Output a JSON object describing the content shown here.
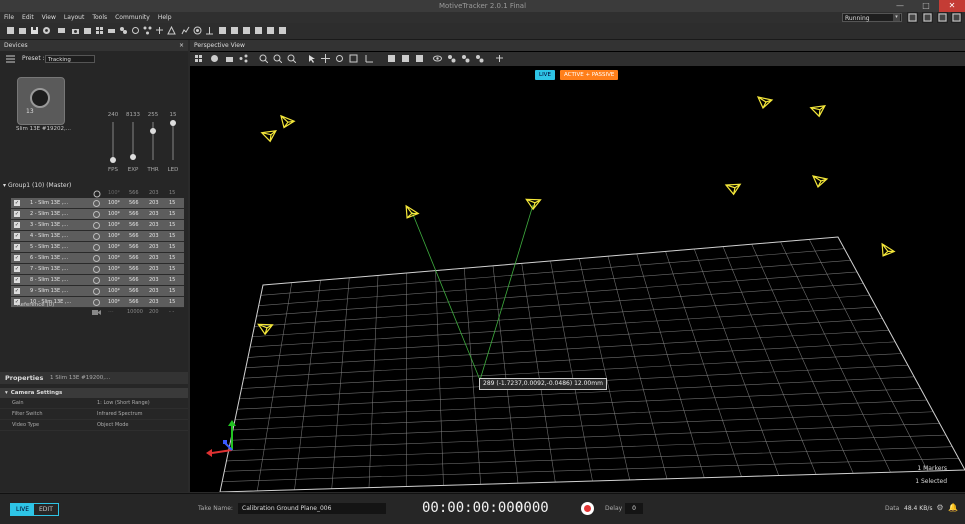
{
  "app": {
    "title": "MotiveTracker 2.0.1 Final"
  },
  "window": {
    "minimize": "—",
    "maximize": "□",
    "close": "✕"
  },
  "menu": [
    "File",
    "Edit",
    "View",
    "Layout",
    "Tools",
    "Community",
    "Help"
  ],
  "toolbar_right": {
    "mode_select": "Running",
    "mode_arrow": "▾"
  },
  "devices_panel": {
    "title": "Devices",
    "close": "×",
    "preset_label": "Preset :",
    "preset_value": "Tracking",
    "camera_name": "Slim 13E #19202,...",
    "camera_number": "13",
    "sliders": [
      {
        "value": "240",
        "label": "FPS",
        "level": 0.0
      },
      {
        "value": "8133",
        "label": "EXP",
        "level": 0.0
      },
      {
        "value": "255",
        "label": "THR",
        "level": 1.0
      },
      {
        "value": "15",
        "label": "LED",
        "level": 1.0
      }
    ],
    "group_label": "Group1 (10) (Master)",
    "group_header": {
      "c1": "100*",
      "c2": "566",
      "c3": "203",
      "c4": "15"
    },
    "rows": [
      {
        "name": "1 - Slim 13E ,...",
        "c1": "100*",
        "c2": "566",
        "c3": "203",
        "c4": "15"
      },
      {
        "name": "2 - Slim 13E ,...",
        "c1": "100*",
        "c2": "566",
        "c3": "203",
        "c4": "15"
      },
      {
        "name": "3 - Slim 13E ,...",
        "c1": "100*",
        "c2": "566",
        "c3": "203",
        "c4": "15"
      },
      {
        "name": "4 - Slim 13E ,...",
        "c1": "100*",
        "c2": "566",
        "c3": "203",
        "c4": "15"
      },
      {
        "name": "5 - Slim 13E ,...",
        "c1": "100*",
        "c2": "566",
        "c3": "203",
        "c4": "15"
      },
      {
        "name": "6 - Slim 13E ,...",
        "c1": "100*",
        "c2": "566",
        "c3": "203",
        "c4": "15"
      },
      {
        "name": "7 - Slim 13E ,...",
        "c1": "100*",
        "c2": "566",
        "c3": "203",
        "c4": "15"
      },
      {
        "name": "8 - Slim 13E ,...",
        "c1": "100*",
        "c2": "566",
        "c3": "203",
        "c4": "15"
      },
      {
        "name": "9 - Slim 13E ,...",
        "c1": "100*",
        "c2": "566",
        "c3": "203",
        "c4": "15"
      },
      {
        "name": "10 - Slim 13E ,...",
        "c1": "100*",
        "c2": "566",
        "c3": "203",
        "c4": "15"
      }
    ],
    "check": "✓",
    "reference_label": "Reference (0)",
    "reference_vals": {
      "c1": "---",
      "c2": "10000",
      "c3": "200",
      "c4": "- -"
    }
  },
  "properties_panel": {
    "title": "Properties",
    "subtitle": "1 Slim 13E #19200,...",
    "section": "Camera Settings",
    "rows": [
      {
        "key": "Gain",
        "value": "1: Low (Short Range)"
      },
      {
        "key": "Filter Switch",
        "value": "Infrared Spectrum"
      },
      {
        "key": "Video Type",
        "value": "Object Mode"
      }
    ]
  },
  "viewport": {
    "title": "Perspective View",
    "badge_live": "LIVE",
    "badge_mode": "ACTIVE + PASSIVE",
    "marker_info": "289 (-1.7237,0.0092,-0.0486) 12.00mm",
    "markers_count": "1 Markers",
    "selected_count": "1 Selected"
  },
  "bottom": {
    "mode_live": "LIVE",
    "mode_edit": "EDIT",
    "take_label": "Take Name:",
    "take_value": "Calibration Ground Plane_006",
    "timecode": "00:00:00:000",
    "frame": "0000",
    "delay_label": "Delay",
    "delay_value": "0",
    "data_label": "Data",
    "data_value": "48.4 KB/s"
  },
  "colors": {
    "accent": "#2ec4e6",
    "orange": "#ff7f1a",
    "camera": "#f3e63a",
    "record": "#e23434"
  }
}
